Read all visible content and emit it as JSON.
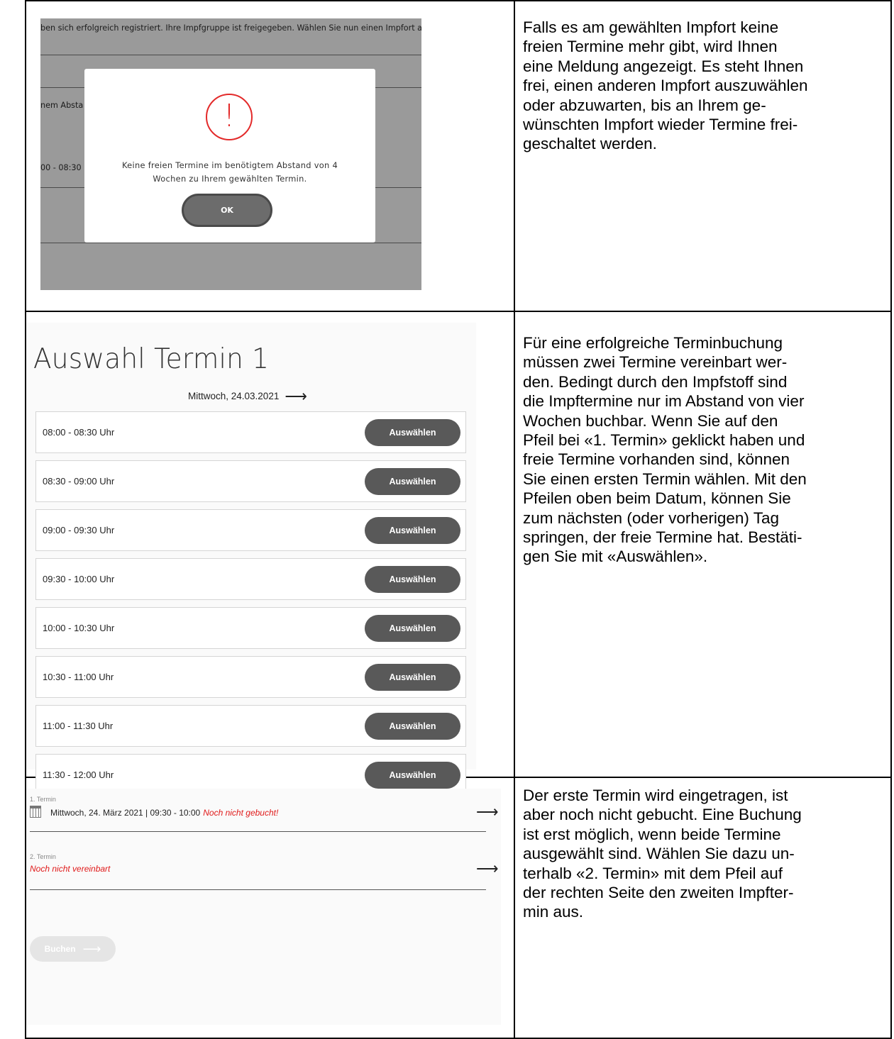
{
  "row1": {
    "background_text_top": "ben sich erfolgreich registriert. Ihre Impfgruppe ist freigegeben. Wählen Sie nun einen Impfort a",
    "background_text_mid": "nem Absta",
    "background_text_time": "00 - 08:30",
    "modal": {
      "icon": "exclamation-circle-icon",
      "icon_glyph": "!",
      "message": "Keine freien Termine im benötigtem Abstand von 4\nWochen zu Ihrem gewählten Termin.",
      "ok_label": "OK"
    },
    "explanation": "Falls es am gewählten Impfort keine\nfreien Termine mehr gibt, wird Ihnen\neine Meldung angezeigt. Es steht Ihnen\nfrei, einen anderen Impfort auszuwählen\noder abzuwarten, bis an Ihrem ge-\nwünschten Impfort wieder Termine frei-\ngeschaltet werden."
  },
  "row2": {
    "title": "Auswahl Termin 1",
    "date": "Mittwoch, 24.03.2021",
    "date_arrow": "⟶",
    "select_label": "Auswählen",
    "slots": [
      "08:00 - 08:30 Uhr",
      "08:30 - 09:00 Uhr",
      "09:00 - 09:30 Uhr",
      "09:30 - 10:00 Uhr",
      "10:00 - 10:30 Uhr",
      "10:30 - 11:00 Uhr",
      "11:00 - 11:30 Uhr",
      "11:30 - 12:00 Uhr"
    ],
    "explanation": "Für eine erfolgreiche Terminbuchung\nmüssen zwei Termine vereinbart wer-\nden. Bedingt durch den Impfstoff sind\ndie Impftermine nur im Abstand von vier\nWochen buchbar. Wenn Sie auf den\nPfeil bei «1. Termin» geklickt haben und\nfreie Termine vorhanden sind, können\nSie einen ersten Termin wählen. Mit den\nPfeilen oben beim Datum, können Sie\nzum nächsten (oder vorherigen) Tag\nspringen, der freie Termine hat. Bestäti-\ngen Sie mit «Auswählen»."
  },
  "row3": {
    "term1_label": "1. Termin",
    "term1_value": "Mittwoch, 24. März 2021 | 09:30 - 10:00",
    "term1_status": "Noch nicht gebucht!",
    "term2_label": "2. Termin",
    "term2_value": "Noch nicht vereinbart",
    "arrow": "⟶",
    "book_label": "Buchen",
    "explanation": "Der erste Termin wird eingetragen, ist\naber noch nicht gebucht. Eine Buchung\nist erst möglich, wenn beide Termine\nausgewählt sind. Wählen Sie dazu un-\nterhalb «2. Termin» mit dem Pfeil auf\nder rechten Seite den zweiten Impfter-\nmin aus."
  },
  "colors": {
    "warning_red": "#e01a1a",
    "button_dark": "#595959",
    "overlay_gray": "#9a9a9a"
  }
}
